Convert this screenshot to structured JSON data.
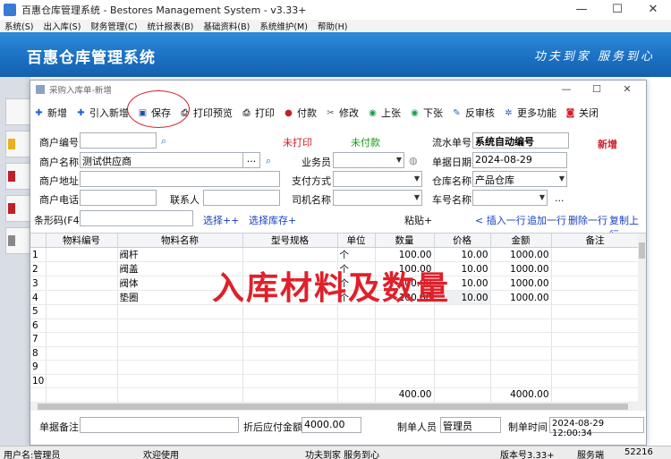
{
  "window": {
    "title": "百惠仓库管理系统 - Bestores Management System - v3.33+"
  },
  "menu": [
    "系统(S)",
    "出入库(S)",
    "财务管理(C)",
    "统计报表(B)",
    "基础资料(B)",
    "系统维护(M)",
    "帮助(H)"
  ],
  "banner": {
    "brand": "百惠仓库管理系统",
    "slogan": "功夫到家 服务到心"
  },
  "dialog": {
    "title": "采购入库单-新增",
    "toolbar": [
      "新增",
      "引入新增",
      "保存",
      "打印预览",
      "打印",
      "付款",
      "修改",
      "上张",
      "下张",
      "反审核",
      "更多功能",
      "关闭"
    ],
    "form": {
      "supplier_code_label": "商户编号",
      "supplier_code": "",
      "status_print": "未打印",
      "status_pay": "未付款",
      "serial_label": "流水单号",
      "serial_value": "系统自动编号",
      "mode": "新增",
      "supplier_name_label": "商户名称",
      "supplier_name": "测试供应商",
      "salesman_label": "业务员",
      "date_label": "单据日期",
      "date_value": "2024-08-29",
      "address_label": "商户地址",
      "payment_label": "支付方式",
      "warehouse_label": "仓库名称",
      "warehouse_value": "产品仓库",
      "phone_label": "商户电话",
      "contact_label": "联系人",
      "driver_label": "司机名称",
      "plate_label": "车号名称",
      "more": "..."
    },
    "barcode": {
      "label": "条形码(F4)",
      "select_pp": "选择++",
      "select_stock": "选择库存+",
      "paste": "粘贴+",
      "insert": "< 插入一行",
      "append": "追加一行",
      "delete": "删除一行",
      "copy": "复制上行"
    },
    "grid": {
      "columns": [
        "物料编号",
        "物料名称",
        "型号规格",
        "单位",
        "数量",
        "价格",
        "金额",
        "备注"
      ],
      "rows": [
        [
          "1",
          "",
          "阀杆",
          "",
          "个",
          "100.00",
          "10.00",
          "1000.00",
          ""
        ],
        [
          "2",
          "",
          "阀盖",
          "",
          "个",
          "100.00",
          "10.00",
          "1000.00",
          ""
        ],
        [
          "3",
          "",
          "阀体",
          "",
          "个",
          "100.00",
          "10.00",
          "1000.00",
          ""
        ],
        [
          "4",
          "",
          "垫圈",
          "",
          "个",
          "100.00",
          "10.00",
          "1000.00",
          ""
        ],
        [
          "5",
          "",
          "",
          "",
          "",
          "",
          "",
          "",
          ""
        ],
        [
          "6",
          "",
          "",
          "",
          "",
          "",
          "",
          "",
          ""
        ],
        [
          "7",
          "",
          "",
          "",
          "",
          "",
          "",
          "",
          ""
        ],
        [
          "8",
          "",
          "",
          "",
          "",
          "",
          "",
          "",
          ""
        ],
        [
          "9",
          "",
          "",
          "",
          "",
          "",
          "",
          "",
          ""
        ],
        [
          "10",
          "",
          "",
          "",
          "",
          "",
          "",
          "",
          ""
        ]
      ],
      "total_qty": "400.00",
      "total_amount": "4000.00",
      "overlay": "入库材料及数量"
    },
    "footer": {
      "remark_label": "单据备注",
      "discount_label": "折后应付金额",
      "discount_value": "4000.00",
      "maker_label": "制单人员",
      "maker_value": "管理员",
      "time_label": "制单时间",
      "time_value": "2024-08-29 12:00:34"
    }
  },
  "status": {
    "user": "用户名:管理员",
    "welcome": "欢迎使用",
    "slogan": "功夫到家 服务到心",
    "version": "版本号3.33+",
    "server": "服务端",
    "port": "52216"
  }
}
